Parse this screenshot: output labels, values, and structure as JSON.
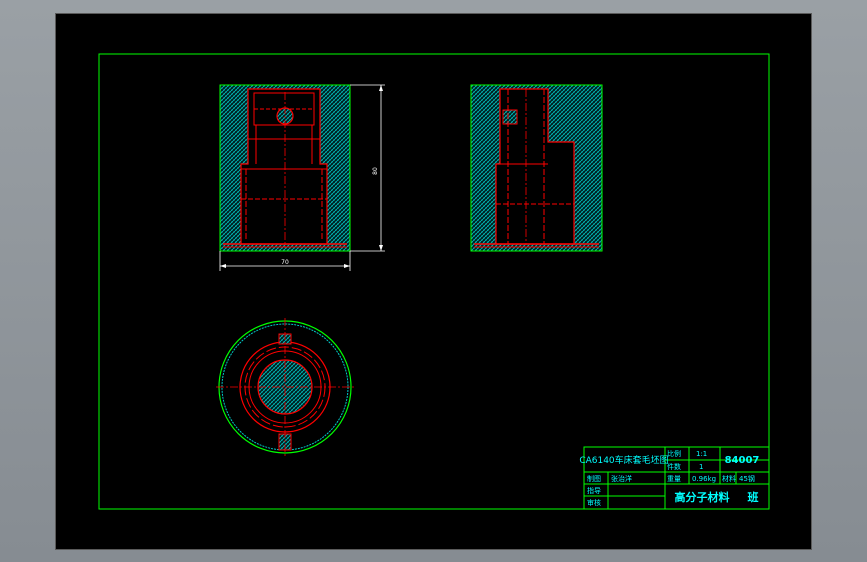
{
  "title_block": {
    "drawing_title": "CA6140车床套毛坯图",
    "scale_label": "比例",
    "scale_value": "1:1",
    "quantity_label": "件数",
    "quantity_value": "1",
    "drawing_number": "84007",
    "drawn_label": "制图",
    "drawn_name": "张治洋",
    "weight_label": "重量",
    "weight_value": "0.96kg",
    "material_label": "材料",
    "material_value": "45钢",
    "instructor_label": "指导",
    "reviewer_label": "审核",
    "school": "高分子材料",
    "class_suffix": "班"
  },
  "dimensions": {
    "overall_height": "80",
    "overall_width": "70"
  },
  "colors": {
    "sheet_background": "#000000",
    "frame": "#00ff00",
    "geometry": "#ff0000",
    "hatch": "#00bfbf",
    "dimension": "#ffffff",
    "title_text": "#00ffff"
  }
}
